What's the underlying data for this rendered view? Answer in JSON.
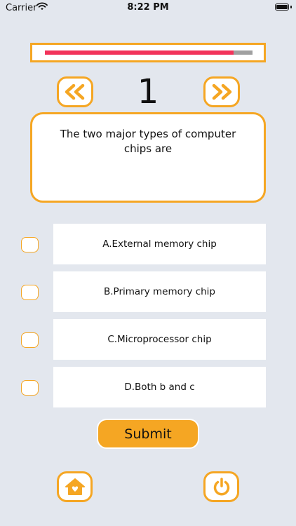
{
  "status_bar": {
    "carrier": "Carrier",
    "time": "8:22 PM",
    "wifi_icon": "wifi-icon",
    "battery_icon": "battery-icon"
  },
  "progress": {
    "fraction": 0.91,
    "fill_color": "#f2335a",
    "track_color": "#a0a0a0"
  },
  "navigation": {
    "prev_icon": "double-chevron-left-icon",
    "next_icon": "double-chevron-right-icon",
    "question_number": "1"
  },
  "question": {
    "text": "The two major types of computer chips are"
  },
  "options": [
    {
      "label": "A.External memory chip",
      "checked": false
    },
    {
      "label": "B.Primary memory chip",
      "checked": false
    },
    {
      "label": "C.Microprocessor chip",
      "checked": false
    },
    {
      "label": "D.Both b and c",
      "checked": false
    }
  ],
  "submit": {
    "label": "Submit"
  },
  "bottom_bar": {
    "home_icon": "home-heart-icon",
    "power_icon": "power-icon"
  },
  "colors": {
    "accent": "#f5a623",
    "background": "#e3e7ee",
    "card": "#ffffff"
  }
}
